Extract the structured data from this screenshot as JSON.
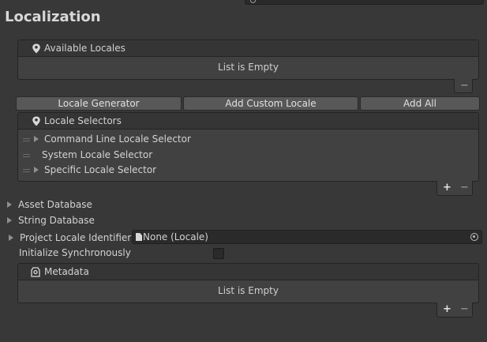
{
  "window": {
    "title": "Localization"
  },
  "available_locales": {
    "header": "Available Locales",
    "empty_text": "List is Empty",
    "remove_label": "−"
  },
  "toolbar": {
    "locale_generator": "Locale Generator",
    "add_custom_locale": "Add Custom Locale",
    "add_all": "Add All"
  },
  "locale_selectors": {
    "header": "Locale Selectors",
    "items": [
      {
        "label": "Command Line Locale Selector",
        "expandable": true
      },
      {
        "label": "System Locale Selector",
        "expandable": false
      },
      {
        "label": "Specific Locale Selector",
        "expandable": true
      }
    ],
    "add_label": "+",
    "remove_label": "−"
  },
  "properties": {
    "asset_database": "Asset Database",
    "string_database": "String Database",
    "project_locale_identifier": {
      "label": "Project Locale Identifier",
      "value": "None (Locale)"
    },
    "initialize_synchronously": {
      "label": "Initialize Synchronously",
      "checked": false
    }
  },
  "metadata": {
    "header": "Metadata",
    "empty_text": "List is Empty",
    "add_label": "+",
    "remove_label": "−"
  },
  "icons": {
    "search": "search-icon",
    "pin": "map-pin-icon",
    "metadata": "metadata-tag-icon",
    "foldout": "foldout-triangle-icon",
    "drag_handle": "drag-handle-icon",
    "document": "document-icon",
    "object_picker": "object-picker-icon"
  }
}
